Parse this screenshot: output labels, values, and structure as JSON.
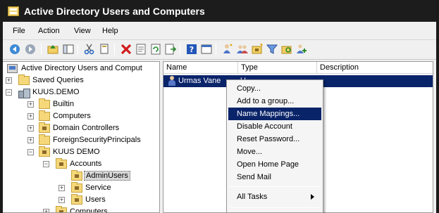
{
  "window": {
    "title": "Active Directory Users and Computers"
  },
  "menu": [
    "File",
    "Action",
    "View",
    "Help"
  ],
  "toolbar": {
    "icons": [
      "back-icon",
      "forward-icon",
      "up-folder-icon",
      "show-hide-console-tree-icon",
      "cut-icon",
      "copy-icon",
      "delete-icon",
      "properties-icon",
      "refresh-icon",
      "export-list-icon",
      "help-icon",
      "console-icon",
      "new-user-icon",
      "new-group-icon",
      "new-ou-icon",
      "filter-icon",
      "find-icon",
      "add-to-group-icon"
    ]
  },
  "tree": [
    {
      "label": "Active Directory Users and Comput",
      "icon": "aduc-icon",
      "level": 0,
      "expander": ""
    },
    {
      "label": "Saved Queries",
      "icon": "folder",
      "level": 1,
      "expander": "+"
    },
    {
      "label": "KUUS.DEMO",
      "icon": "domain",
      "level": 1,
      "expander": "−"
    },
    {
      "label": "Builtin",
      "icon": "folder",
      "level": 2,
      "expander": "+"
    },
    {
      "label": "Computers",
      "icon": "folder",
      "level": 2,
      "expander": "+"
    },
    {
      "label": "Domain Controllers",
      "icon": "ou",
      "level": 2,
      "expander": "+"
    },
    {
      "label": "ForeignSecurityPrincipals",
      "icon": "folder",
      "level": 2,
      "expander": "+"
    },
    {
      "label": "KUUS DEMO",
      "icon": "ou",
      "level": 2,
      "expander": "−"
    },
    {
      "label": "Accounts",
      "icon": "ou",
      "level": 3,
      "expander": "−"
    },
    {
      "label": "AdminUsers",
      "icon": "ou",
      "level": 4,
      "expander": "",
      "selected": true
    },
    {
      "label": "Service",
      "icon": "ou",
      "level": 4,
      "expander": "+"
    },
    {
      "label": "Users",
      "icon": "ou",
      "level": 4,
      "expander": "+"
    },
    {
      "label": "Computers",
      "icon": "ou",
      "level": 3,
      "expander": "+"
    }
  ],
  "list": {
    "columns": [
      "Name",
      "Type",
      "Description"
    ],
    "rows": [
      {
        "name": "Urmas Vane",
        "type": "U"
      }
    ]
  },
  "context_menu": {
    "items": [
      {
        "label": "Copy..."
      },
      {
        "label": "Add to a group..."
      },
      {
        "label": "Name Mappings...",
        "highlighted": true
      },
      {
        "label": "Disable Account"
      },
      {
        "label": "Reset Password..."
      },
      {
        "label": "Move..."
      },
      {
        "label": "Open Home Page"
      },
      {
        "label": "Send Mail"
      },
      {
        "separator": true
      },
      {
        "label": "All Tasks",
        "submenu": true
      },
      {
        "separator": true
      }
    ]
  }
}
